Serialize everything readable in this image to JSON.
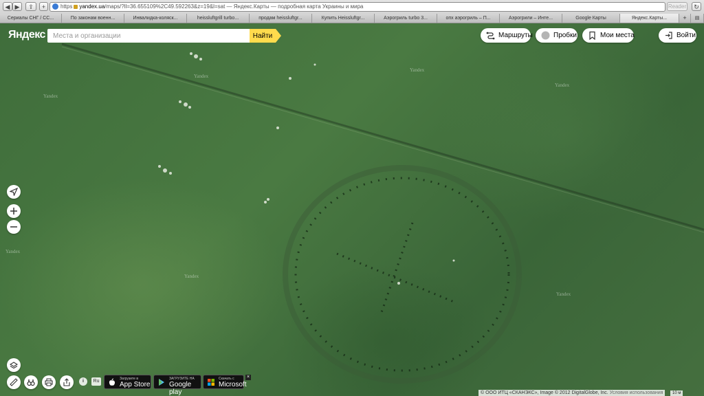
{
  "browser": {
    "url_scheme": "https",
    "url_host": "yandex.ua",
    "url_rest": "/maps/?ll=36.655109%2C49.592263&z=19&l=sat",
    "url_title": " — Яндекс.Карты — подробная карта Украины и мира",
    "reader_label": "Reader",
    "tabs": [
      "Сериалы СНГ / СС...",
      "По законам военн...",
      "Инвалидка-коляск...",
      "heissluftgrill turbo...",
      "продам heissluftgr...",
      "Купить Heissluftgr...",
      "Аэрогриль turbo 3...",
      "опх аэрогриль – П...",
      "Аэрогрили – Инте...",
      "Google Карты",
      "Яндекс.Карты..."
    ]
  },
  "header": {
    "logo": "Яндекс",
    "search_placeholder": "Места и организации",
    "search_button": "Найти",
    "routes": "Маршруты",
    "traffic": "Пробки",
    "my_places": "Мои места",
    "login": "Войти"
  },
  "map": {
    "watermark": "Yandex"
  },
  "footer": {
    "lang": "Ru",
    "appstore_small": "Загрузите в",
    "appstore_big": "App Store",
    "google_small": "ЗАГРУЗИТЕ НА",
    "google_big": "Google play",
    "ms_small": "Скачать с",
    "ms_big": "Microsoft",
    "close": "×",
    "copyright": "© ООО ИТЦ «СКАНЭКС», Image © 2012 DigitalGlobe, Inc.",
    "terms": "Условия использования",
    "scale": "10 м"
  },
  "colors": {
    "accent": "#ffdb4d",
    "map_green": "#3f6d3b"
  }
}
